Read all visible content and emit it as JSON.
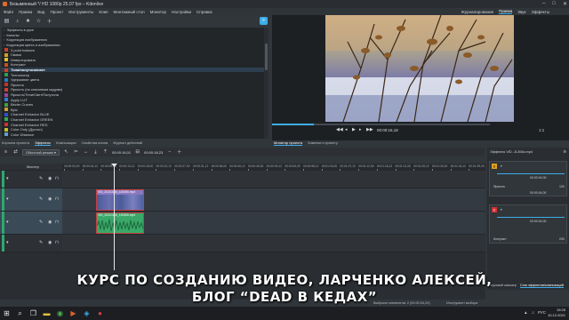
{
  "window": {
    "title": "Безымянный */ HD 1080p 25.07 fps – Kdenlive"
  },
  "menu": [
    "Файл",
    "Правка",
    "Вид",
    "Проект",
    "Инструменты",
    "Клип",
    "Монтажный стол",
    "Монитор",
    "Настройки",
    "Справка"
  ],
  "workspaces": [
    "Журналирование",
    "Правка",
    "Звук",
    "Эффекты"
  ],
  "effects_list": [
    {
      "label": "Эффекты в руке",
      "kind": "cat"
    },
    {
      "label": "Каналы",
      "kind": "cat"
    },
    {
      "label": "Коррекция изображения",
      "kind": "cat"
    },
    {
      "label": "Коррекция цвета и изображения",
      "kind": "cat"
    },
    {
      "label": "3 point balance",
      "color": "#c8402a"
    },
    {
      "label": "Гамма",
      "color": "#d8a020"
    },
    {
      "label": "Инвертировать",
      "color": "#e0c030"
    },
    {
      "label": "Контраст",
      "color": "#c85020"
    },
    {
      "label": "Тона/полутона/свет",
      "color": "#d04020",
      "bold": true,
      "sel": true
    },
    {
      "label": "Технологер",
      "color": "#30a050"
    },
    {
      "label": "Удержание цвета",
      "color": "#2080c0"
    },
    {
      "label": "Яркость",
      "color": "#c83030"
    },
    {
      "label": "Яркость (по ключевым кадрам)",
      "color": "#d04030"
    },
    {
      "label": "Яркость/Тени/Свет/Полутона",
      "color": "#a040a0"
    },
    {
      "label": "Apply LUT",
      "color": "#3080d0"
    },
    {
      "label": "Bézier Curves",
      "color": "#40a040"
    },
    {
      "label": "Bpic",
      "color": "#d0a030"
    },
    {
      "label": "Channel Extractor BLUE",
      "color": "#3050d0"
    },
    {
      "label": "Channel Extractor GREEN",
      "color": "#30b050"
    },
    {
      "label": "Channel Extractor RED",
      "color": "#d03030"
    },
    {
      "label": "Color Only (Дуотон)",
      "color": "#c0c030"
    },
    {
      "label": "Color Distance",
      "color": "#60a0d0"
    }
  ],
  "left_tabs": [
    "Корзина проекта",
    "Эффекты",
    "Композиции",
    "Свойства клипа",
    "Журнал действий"
  ],
  "right_tabs": [
    "Монитор проекта",
    "Заметки к проекту"
  ],
  "monitor": {
    "timecode": "00:00:16,18",
    "zoom": "1:1",
    "progress": 0.19
  },
  "timeline": {
    "mode": "Обычный режим",
    "timecode_pos": "00:00:16,01",
    "timecode_dur": "00:00:18,23",
    "master": "Мастер",
    "ruler": [
      "00:00:00,00",
      "00:00:04,12",
      "00:00:09,00",
      "00:00:13,12",
      "00:00:18,00",
      "00:00:22,12",
      "00:00:27,00",
      "00:00:31,12",
      "00:00:36,00",
      "00:00:40,12",
      "00:00:45,00",
      "00:00:49,12",
      "00:00:54,00",
      "00:00:58,12",
      "00:01:03,00",
      "00:01:07,12",
      "00:01:12,00",
      "00:01:16,12",
      "00:01:21,00",
      "00:01:25,12",
      "00:01:30,00",
      "00:01:34,12",
      "00:01:39,00"
    ],
    "clip_v": "VID_20210106_100306.mp4",
    "clip_a": "VID_20210106_100306.mp4"
  },
  "effect_stack": {
    "header": "Эффекты VID...8-306a.mp4",
    "block1_badge": "T",
    "block1_tc1": "00:00:04,00",
    "block1_label": "Яркость",
    "block1_val": "100",
    "block1_tc2": "00:00:04,00",
    "block2_badge": "T",
    "block2_tc": "00:00:04,00",
    "block2_label": "Контраст",
    "block2_val": "200",
    "tabs": [
      "Звуковой микшер",
      "Стек эффектов/композиций"
    ]
  },
  "status": {
    "selected": "Выбрано элементов: 2 (00:00:04,24)",
    "snap": "Инструмент выбора"
  },
  "caption": [
    "КУРС ПО СОЗДАНИЮ ВИДЕО, ЛАРЧЕНКО АЛЕКСЕЙ,",
    "БЛОГ “DEAD В КЕДАХ”"
  ],
  "tray": {
    "lang": "РУС",
    "time": "19:25",
    "date": "10.12.2021"
  },
  "colors": {
    "accent": "#3daee9",
    "track_tag": "#2fa870",
    "clip_video": "#8a78c0",
    "clip_audio": "#3aa868"
  }
}
